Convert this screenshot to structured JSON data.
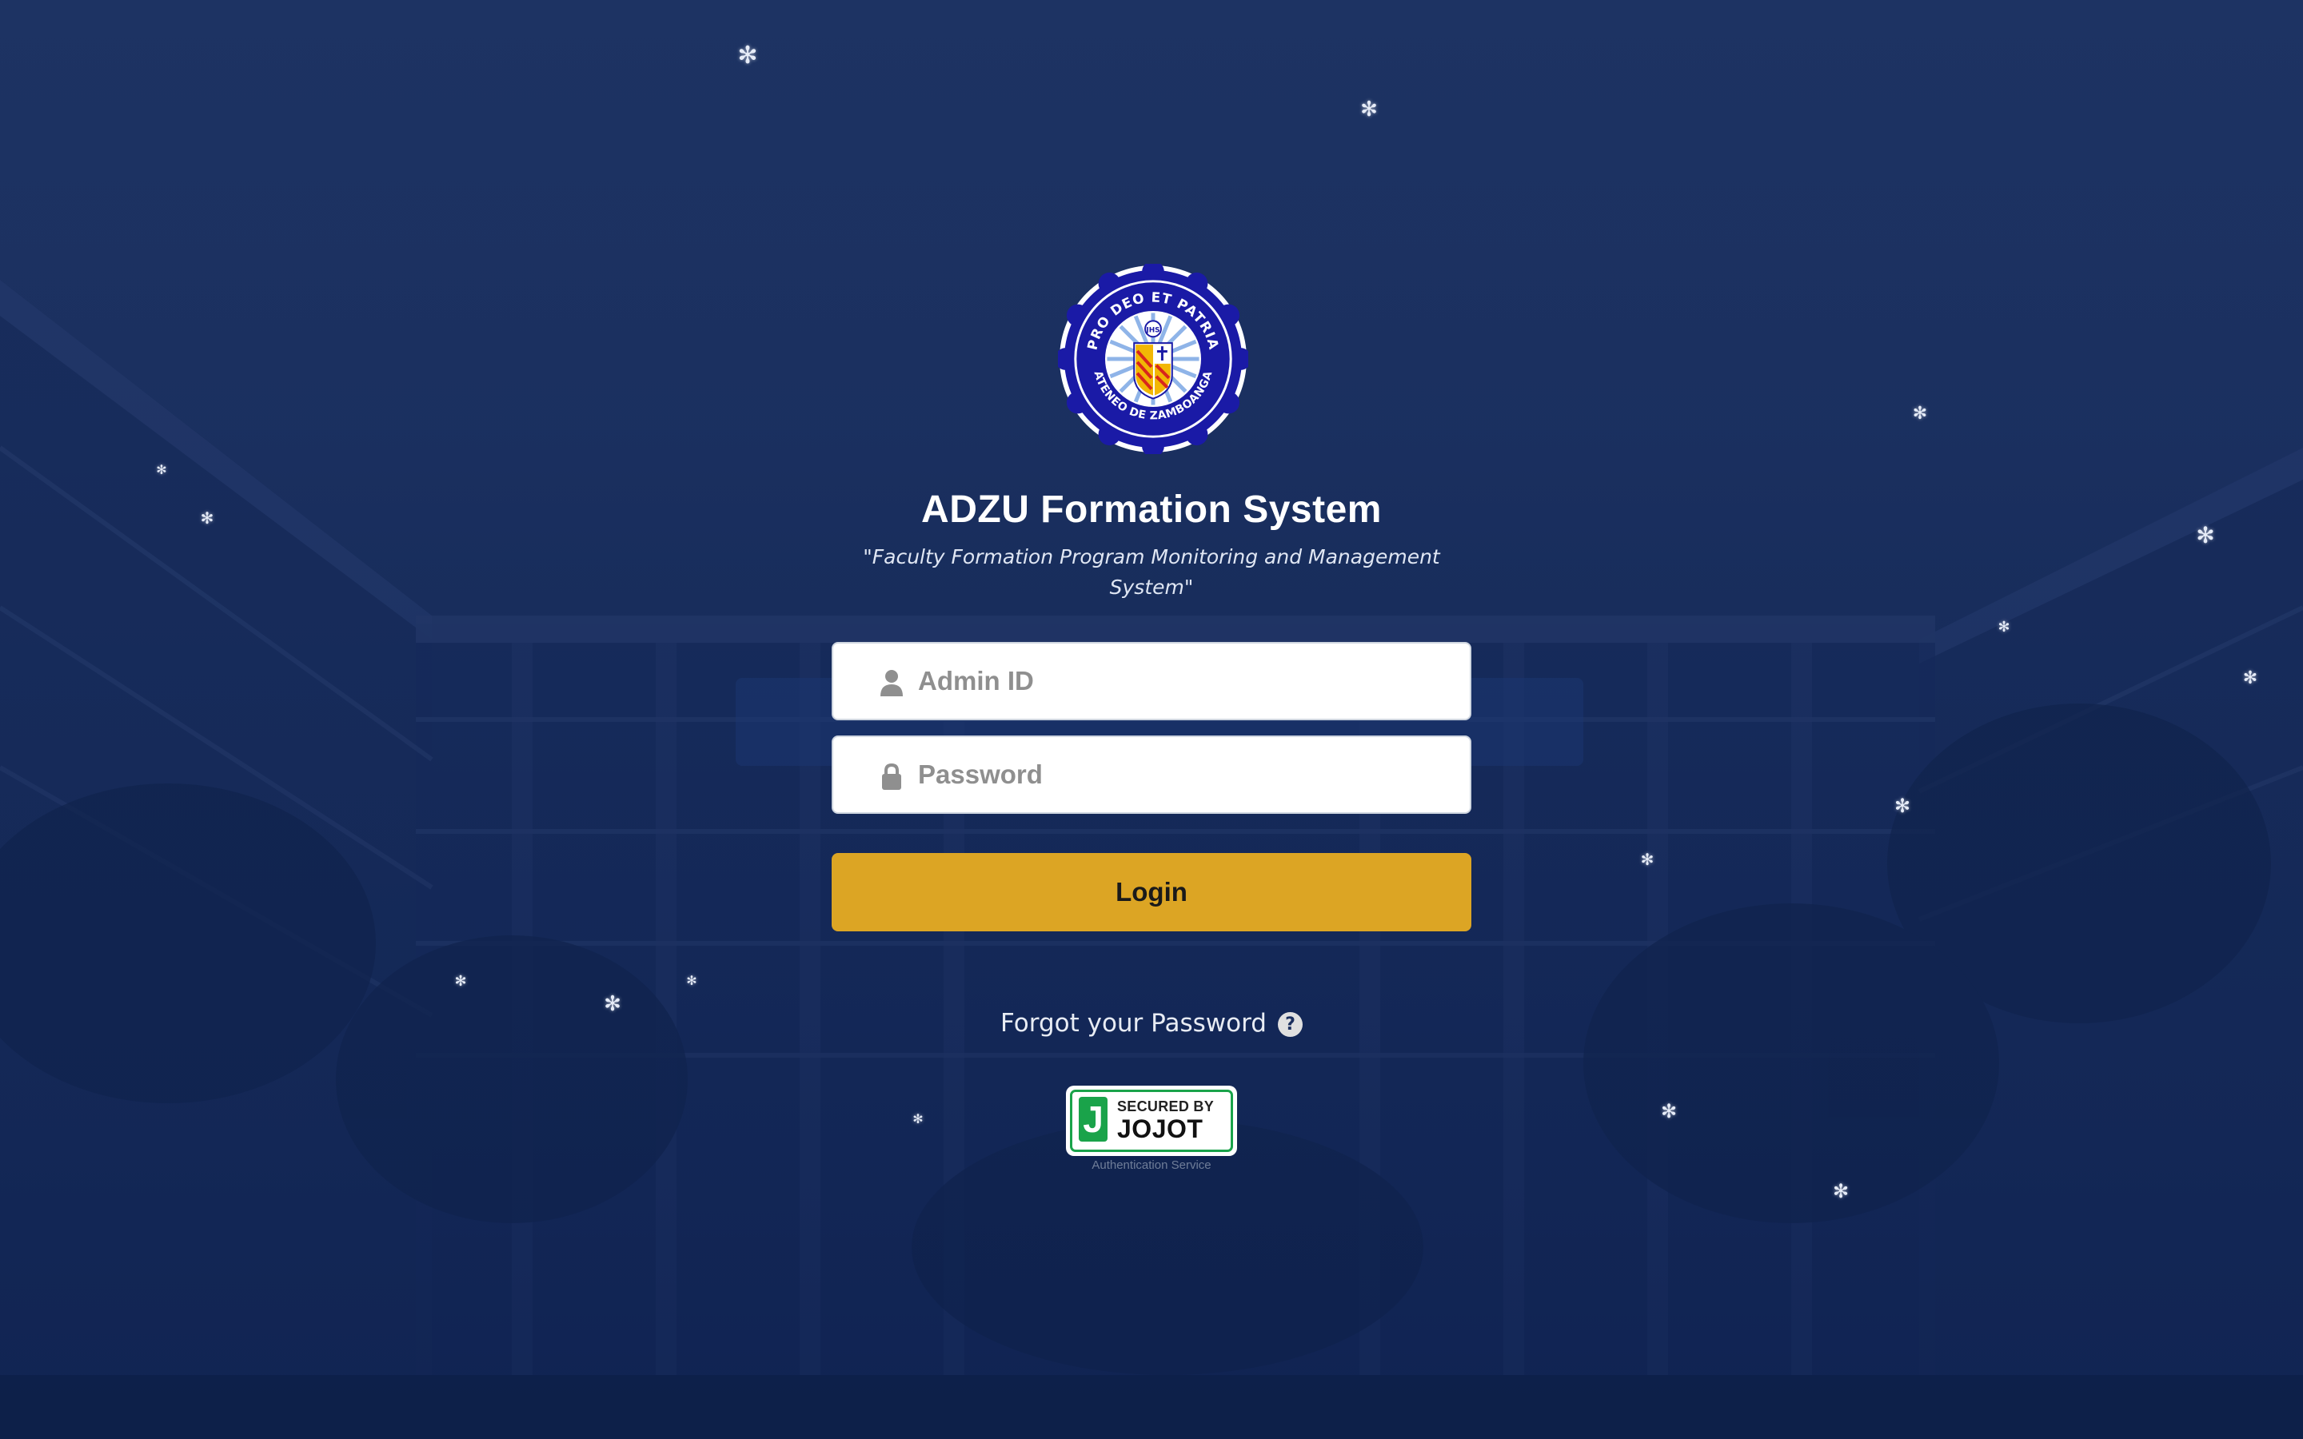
{
  "app": {
    "title": "ADZU Formation System",
    "subtitle": "\"Faculty Formation Program Monitoring and Management System\""
  },
  "seal": {
    "motto_top": "PRO DEO ET PATRIA",
    "motto_bottom": "ATENEO DE ZAMBOANGA",
    "monogram": "JHS"
  },
  "form": {
    "admin_id": {
      "placeholder": "Admin ID",
      "value": "",
      "icon": "user-icon"
    },
    "password": {
      "placeholder": "Password",
      "value": "",
      "icon": "lock-icon"
    },
    "login_label": "Login"
  },
  "forgot": {
    "label": "Forgot your Password",
    "help_glyph": "?"
  },
  "badge": {
    "letter": "J",
    "top_text": "SECURED BY",
    "main_text": "JOJOT",
    "caption": "Authentication Service"
  },
  "colors": {
    "background": "#1b2f5e",
    "login_button": "#dca524",
    "badge_green": "#1aa34a",
    "seal_blue": "#1a1aa6"
  }
}
